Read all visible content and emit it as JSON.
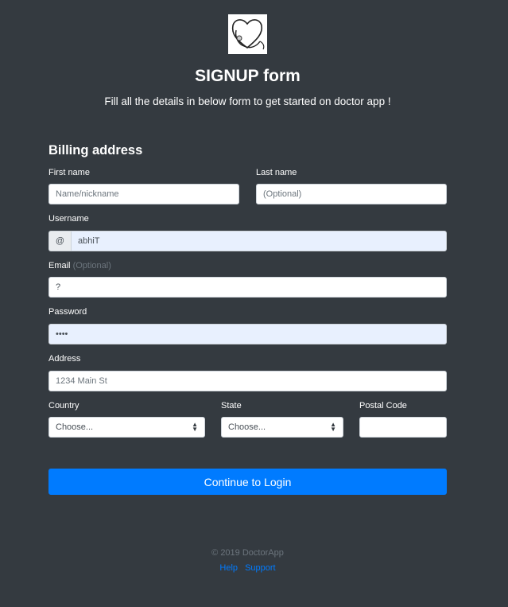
{
  "header": {
    "logo_icon": "heart-stethoscope-icon",
    "title": "SIGNUP form",
    "subtitle": "Fill all the details in below form to get started on doctor app !"
  },
  "form": {
    "section_title": "Billing address",
    "first_name": {
      "label": "First name",
      "placeholder": "Name/nickname",
      "value": ""
    },
    "last_name": {
      "label": "Last name",
      "placeholder": "(Optional)",
      "value": ""
    },
    "username": {
      "label": "Username",
      "prefix": "@",
      "value": "abhiT"
    },
    "email": {
      "label": "Email",
      "label_hint": "(Optional)",
      "value": "?"
    },
    "password": {
      "label": "Password",
      "value": "••••"
    },
    "address": {
      "label": "Address",
      "placeholder": "1234 Main St",
      "value": ""
    },
    "country": {
      "label": "Country",
      "selected": "Choose..."
    },
    "state": {
      "label": "State",
      "selected": "Choose..."
    },
    "postal_code": {
      "label": "Postal Code",
      "value": ""
    },
    "submit_label": "Continue to Login"
  },
  "footer": {
    "copyright": "© 2019 DoctorApp",
    "links": [
      "Help",
      "Support"
    ]
  },
  "colors": {
    "background": "#343a40",
    "primary": "#007bff",
    "autofill": "#e8f0fe"
  }
}
